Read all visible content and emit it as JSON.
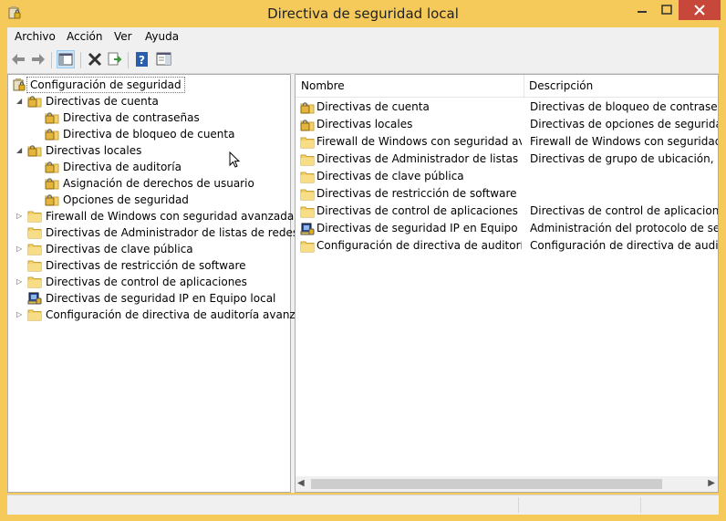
{
  "window": {
    "title": "Directiva de seguridad local",
    "frame_color": "#f5c95a",
    "close_color": "#c7473b",
    "buttons": [
      "minimize-icon",
      "maximize-icon",
      "close-icon"
    ]
  },
  "menu": [
    "Archivo",
    "Acción",
    "Ver",
    "Ayuda"
  ],
  "toolbar": [
    "back-arrow-icon",
    "forward-arrow-icon",
    "show-hide-tree-icon",
    "delete-icon",
    "export-list-icon",
    "help-icon",
    "properties-panel-icon"
  ],
  "tree": [
    {
      "label": "Configuración de seguridad",
      "level": 0,
      "icon": "security-settings-icon",
      "expander": "",
      "selected": true
    },
    {
      "label": "Directivas de cuenta",
      "level": 1,
      "icon": "locked-folder-icon",
      "expander": "◢"
    },
    {
      "label": "Directiva de contraseñas",
      "level": 2,
      "icon": "locked-folder-icon",
      "expander": ""
    },
    {
      "label": "Directiva de bloqueo de cuenta",
      "level": 2,
      "icon": "locked-folder-icon",
      "expander": ""
    },
    {
      "label": "Directivas locales",
      "level": 1,
      "icon": "locked-folder-icon",
      "expander": "◢"
    },
    {
      "label": "Directiva de auditoría",
      "level": 2,
      "icon": "locked-folder-icon",
      "expander": ""
    },
    {
      "label": "Asignación de derechos de usuario",
      "level": 2,
      "icon": "locked-folder-icon",
      "expander": ""
    },
    {
      "label": "Opciones de seguridad",
      "level": 2,
      "icon": "locked-folder-icon",
      "expander": ""
    },
    {
      "label": "Firewall de Windows con seguridad avanzada",
      "level": 1,
      "icon": "folder-icon",
      "expander": "▷"
    },
    {
      "label": "Directivas de Administrador de listas de redes",
      "level": 1,
      "icon": "folder-icon",
      "expander": ""
    },
    {
      "label": "Directivas de clave pública",
      "level": 1,
      "icon": "folder-icon",
      "expander": "▷"
    },
    {
      "label": "Directivas de restricción de software",
      "level": 1,
      "icon": "folder-icon",
      "expander": ""
    },
    {
      "label": "Directivas de control de aplicaciones",
      "level": 1,
      "icon": "folder-icon",
      "expander": "▷"
    },
    {
      "label": "Directivas de seguridad IP en Equipo local",
      "level": 1,
      "icon": "ip-security-icon",
      "expander": ""
    },
    {
      "label": "Configuración de directiva de auditoría avanzada",
      "level": 1,
      "icon": "folder-icon",
      "expander": "▷"
    }
  ],
  "list": {
    "columns": [
      "Nombre",
      "Descripción"
    ],
    "rows": [
      {
        "name": "Directivas de cuenta",
        "desc": "Directivas de bloqueo de contraseña y c",
        "icon": "locked-folder-icon"
      },
      {
        "name": "Directivas locales",
        "desc": "Directivas de opciones de seguridad, de",
        "icon": "locked-folder-icon"
      },
      {
        "name": "Firewall de Windows con seguridad avan...",
        "desc": "Firewall de Windows con seguridad ava",
        "icon": "folder-icon"
      },
      {
        "name": "Directivas de Administrador de listas de r...",
        "desc": "Directivas de grupo de ubicación, icono",
        "icon": "folder-icon"
      },
      {
        "name": "Directivas de clave pública",
        "desc": "",
        "icon": "folder-icon"
      },
      {
        "name": "Directivas de restricción de software",
        "desc": "",
        "icon": "folder-icon"
      },
      {
        "name": "Directivas de control de aplicaciones",
        "desc": "Directivas de control de aplicaciones",
        "icon": "folder-icon"
      },
      {
        "name": "Directivas de seguridad IP en Equipo local",
        "desc": "Administración del protocolo de seguri",
        "icon": "ip-security-icon"
      },
      {
        "name": "Configuración de directiva de auditoría a...",
        "desc": "Configuración de directiva de auditoría",
        "icon": "folder-icon"
      }
    ]
  },
  "scrollbar": {
    "left_arrow": "◀",
    "right_arrow": "▶"
  }
}
